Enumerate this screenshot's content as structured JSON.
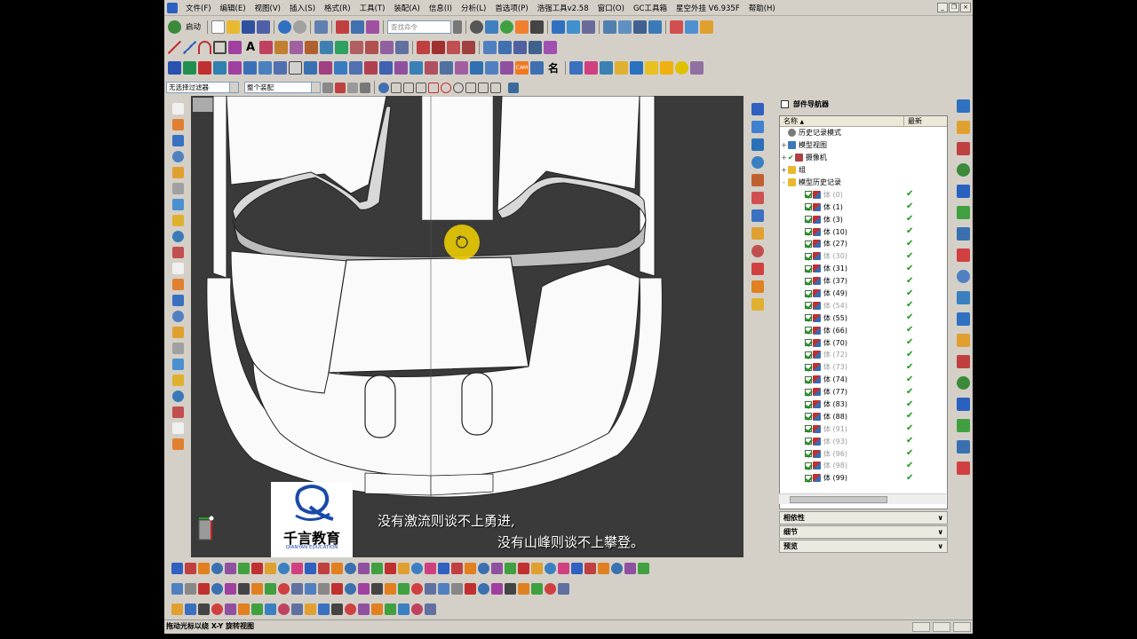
{
  "menu": [
    "文件(F)",
    "编辑(E)",
    "视图(V)",
    "插入(S)",
    "格式(R)",
    "工具(T)",
    "装配(A)",
    "信息(I)",
    "分析(L)",
    "首选项(P)",
    "浩强工具v2.58",
    "窗口(O)",
    "GC工具箱",
    "星空外挂 V6.935F",
    "帮助(H)"
  ],
  "toolbar": {
    "start_label": "启动",
    "search_placeholder": "查找命令"
  },
  "selection": {
    "filter_value": "无选择过滤器",
    "scope_value": "整个装配"
  },
  "navigator": {
    "title": "部件导航器",
    "col_name": "名称",
    "col_latest": "最新",
    "top_items": [
      {
        "label": "历史记录模式",
        "expand": "",
        "icon": "clock"
      },
      {
        "label": "模型视图",
        "expand": "+",
        "icon": "view"
      },
      {
        "label": "摄像机",
        "expand": "+",
        "icon": "camera"
      },
      {
        "label": "组",
        "expand": "+",
        "icon": "folder"
      },
      {
        "label": "模型历史记录",
        "expand": "-",
        "icon": "folder"
      }
    ],
    "bodies": [
      {
        "label": "体 (0)",
        "dim": true
      },
      {
        "label": "体 (1)",
        "dim": false
      },
      {
        "label": "体 (3)",
        "dim": false
      },
      {
        "label": "体 (10)",
        "dim": false
      },
      {
        "label": "体 (27)",
        "dim": false
      },
      {
        "label": "体 (30)",
        "dim": true
      },
      {
        "label": "体 (31)",
        "dim": false
      },
      {
        "label": "体 (37)",
        "dim": false
      },
      {
        "label": "体 (49)",
        "dim": false
      },
      {
        "label": "体 (54)",
        "dim": true
      },
      {
        "label": "体 (55)",
        "dim": false
      },
      {
        "label": "体 (66)",
        "dim": false
      },
      {
        "label": "体 (70)",
        "dim": false
      },
      {
        "label": "体 (72)",
        "dim": true
      },
      {
        "label": "体 (73)",
        "dim": true
      },
      {
        "label": "体 (74)",
        "dim": false
      },
      {
        "label": "体 (77)",
        "dim": false
      },
      {
        "label": "体 (83)",
        "dim": false
      },
      {
        "label": "体 (88)",
        "dim": false
      },
      {
        "label": "体 (91)",
        "dim": true
      },
      {
        "label": "体 (93)",
        "dim": true
      },
      {
        "label": "体 (96)",
        "dim": true
      },
      {
        "label": "体 (98)",
        "dim": true
      },
      {
        "label": "体 (99)",
        "dim": false
      }
    ],
    "panels": [
      "相依性",
      "细节",
      "预览"
    ]
  },
  "watermark": {
    "brand": "千言教育",
    "brand_en": "QIANYAN EDUCATION",
    "line1": "没有激流则谈不上勇进,",
    "line2": "没有山峰则谈不上攀登。"
  },
  "status_text": "拖动光标以绕 X-Y 旋转视图",
  "colors": {
    "ui_bg": "#d4d0c8",
    "viewport_bg": "#3a3a3a",
    "check_green": "#1a9a1a",
    "cursor_highlight": "#f5d400"
  }
}
